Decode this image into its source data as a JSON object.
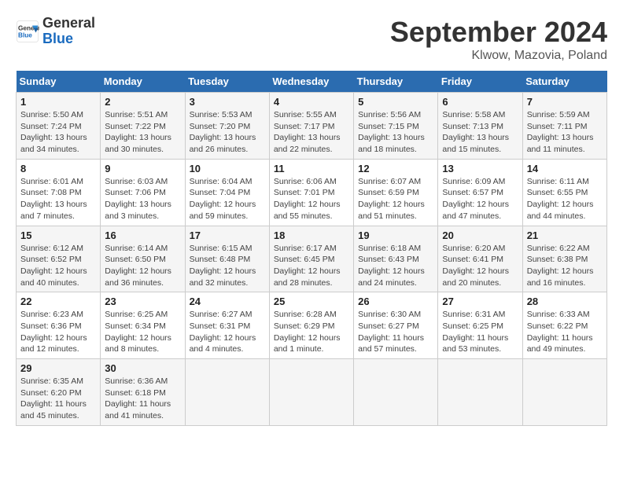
{
  "header": {
    "logo_line1": "General",
    "logo_line2": "Blue",
    "title": "September 2024",
    "subtitle": "Klwow, Mazovia, Poland"
  },
  "weekdays": [
    "Sunday",
    "Monday",
    "Tuesday",
    "Wednesday",
    "Thursday",
    "Friday",
    "Saturday"
  ],
  "weeks": [
    [
      {
        "day": "1",
        "detail": "Sunrise: 5:50 AM\nSunset: 7:24 PM\nDaylight: 13 hours\nand 34 minutes."
      },
      {
        "day": "2",
        "detail": "Sunrise: 5:51 AM\nSunset: 7:22 PM\nDaylight: 13 hours\nand 30 minutes."
      },
      {
        "day": "3",
        "detail": "Sunrise: 5:53 AM\nSunset: 7:20 PM\nDaylight: 13 hours\nand 26 minutes."
      },
      {
        "day": "4",
        "detail": "Sunrise: 5:55 AM\nSunset: 7:17 PM\nDaylight: 13 hours\nand 22 minutes."
      },
      {
        "day": "5",
        "detail": "Sunrise: 5:56 AM\nSunset: 7:15 PM\nDaylight: 13 hours\nand 18 minutes."
      },
      {
        "day": "6",
        "detail": "Sunrise: 5:58 AM\nSunset: 7:13 PM\nDaylight: 13 hours\nand 15 minutes."
      },
      {
        "day": "7",
        "detail": "Sunrise: 5:59 AM\nSunset: 7:11 PM\nDaylight: 13 hours\nand 11 minutes."
      }
    ],
    [
      {
        "day": "8",
        "detail": "Sunrise: 6:01 AM\nSunset: 7:08 PM\nDaylight: 13 hours\nand 7 minutes."
      },
      {
        "day": "9",
        "detail": "Sunrise: 6:03 AM\nSunset: 7:06 PM\nDaylight: 13 hours\nand 3 minutes."
      },
      {
        "day": "10",
        "detail": "Sunrise: 6:04 AM\nSunset: 7:04 PM\nDaylight: 12 hours\nand 59 minutes."
      },
      {
        "day": "11",
        "detail": "Sunrise: 6:06 AM\nSunset: 7:01 PM\nDaylight: 12 hours\nand 55 minutes."
      },
      {
        "day": "12",
        "detail": "Sunrise: 6:07 AM\nSunset: 6:59 PM\nDaylight: 12 hours\nand 51 minutes."
      },
      {
        "day": "13",
        "detail": "Sunrise: 6:09 AM\nSunset: 6:57 PM\nDaylight: 12 hours\nand 47 minutes."
      },
      {
        "day": "14",
        "detail": "Sunrise: 6:11 AM\nSunset: 6:55 PM\nDaylight: 12 hours\nand 44 minutes."
      }
    ],
    [
      {
        "day": "15",
        "detail": "Sunrise: 6:12 AM\nSunset: 6:52 PM\nDaylight: 12 hours\nand 40 minutes."
      },
      {
        "day": "16",
        "detail": "Sunrise: 6:14 AM\nSunset: 6:50 PM\nDaylight: 12 hours\nand 36 minutes."
      },
      {
        "day": "17",
        "detail": "Sunrise: 6:15 AM\nSunset: 6:48 PM\nDaylight: 12 hours\nand 32 minutes."
      },
      {
        "day": "18",
        "detail": "Sunrise: 6:17 AM\nSunset: 6:45 PM\nDaylight: 12 hours\nand 28 minutes."
      },
      {
        "day": "19",
        "detail": "Sunrise: 6:18 AM\nSunset: 6:43 PM\nDaylight: 12 hours\nand 24 minutes."
      },
      {
        "day": "20",
        "detail": "Sunrise: 6:20 AM\nSunset: 6:41 PM\nDaylight: 12 hours\nand 20 minutes."
      },
      {
        "day": "21",
        "detail": "Sunrise: 6:22 AM\nSunset: 6:38 PM\nDaylight: 12 hours\nand 16 minutes."
      }
    ],
    [
      {
        "day": "22",
        "detail": "Sunrise: 6:23 AM\nSunset: 6:36 PM\nDaylight: 12 hours\nand 12 minutes."
      },
      {
        "day": "23",
        "detail": "Sunrise: 6:25 AM\nSunset: 6:34 PM\nDaylight: 12 hours\nand 8 minutes."
      },
      {
        "day": "24",
        "detail": "Sunrise: 6:27 AM\nSunset: 6:31 PM\nDaylight: 12 hours\nand 4 minutes."
      },
      {
        "day": "25",
        "detail": "Sunrise: 6:28 AM\nSunset: 6:29 PM\nDaylight: 12 hours\nand 1 minute."
      },
      {
        "day": "26",
        "detail": "Sunrise: 6:30 AM\nSunset: 6:27 PM\nDaylight: 11 hours\nand 57 minutes."
      },
      {
        "day": "27",
        "detail": "Sunrise: 6:31 AM\nSunset: 6:25 PM\nDaylight: 11 hours\nand 53 minutes."
      },
      {
        "day": "28",
        "detail": "Sunrise: 6:33 AM\nSunset: 6:22 PM\nDaylight: 11 hours\nand 49 minutes."
      }
    ],
    [
      {
        "day": "29",
        "detail": "Sunrise: 6:35 AM\nSunset: 6:20 PM\nDaylight: 11 hours\nand 45 minutes."
      },
      {
        "day": "30",
        "detail": "Sunrise: 6:36 AM\nSunset: 6:18 PM\nDaylight: 11 hours\nand 41 minutes."
      },
      {
        "day": "",
        "detail": ""
      },
      {
        "day": "",
        "detail": ""
      },
      {
        "day": "",
        "detail": ""
      },
      {
        "day": "",
        "detail": ""
      },
      {
        "day": "",
        "detail": ""
      }
    ]
  ]
}
